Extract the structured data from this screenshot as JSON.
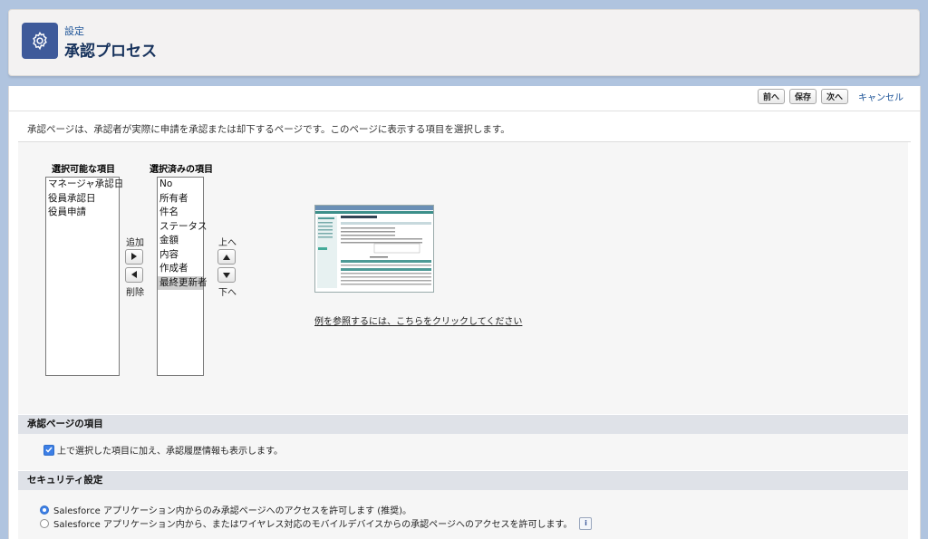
{
  "header": {
    "eyebrow": "設定",
    "title": "承認プロセス",
    "icon": "gear-icon"
  },
  "toolbar": {
    "prev_label": "前へ",
    "save_label": "保存",
    "next_label": "次へ",
    "cancel_label": "キャンセル"
  },
  "intro": "承認ページは、承認者が実際に申請を承認または却下するページです。このページに表示する項目を選択します。",
  "available": {
    "title": "選択可能な項目",
    "items": [
      "マネージャ承認日",
      "役員承認日",
      "役員申請"
    ]
  },
  "selected": {
    "title": "選択済みの項目",
    "items": [
      "No",
      "所有者",
      "件名",
      "ステータス",
      "金額",
      "内容",
      "作成者",
      "最終更新者"
    ],
    "highlighted": "最終更新者"
  },
  "controls": {
    "add_label": "追加",
    "remove_label": "削除",
    "up_label": "上へ",
    "down_label": "下へ"
  },
  "example_link": "例を参照するには、こちらをクリックしてください",
  "approval_fields": {
    "title": "承認ページの項目",
    "checkbox_label": "上で選択した項目に加え、承認履歴情報も表示します。",
    "checked": true
  },
  "security": {
    "title": "セキュリティ設定",
    "options": [
      {
        "label": "Salesforce アプリケーション内からのみ承認ページへのアクセスを許可します (推奨)。",
        "selected": true
      },
      {
        "label": "Salesforce アプリケーション内から、またはワイヤレス対応のモバイルデバイスからの承認ページへのアクセスを許可します。",
        "selected": false
      }
    ],
    "info_icon": "info-icon"
  },
  "colors": {
    "accent": "#3e5a9a",
    "link": "#1b5297",
    "required": "#cc0000",
    "checkbox": "#3d7fe6"
  }
}
